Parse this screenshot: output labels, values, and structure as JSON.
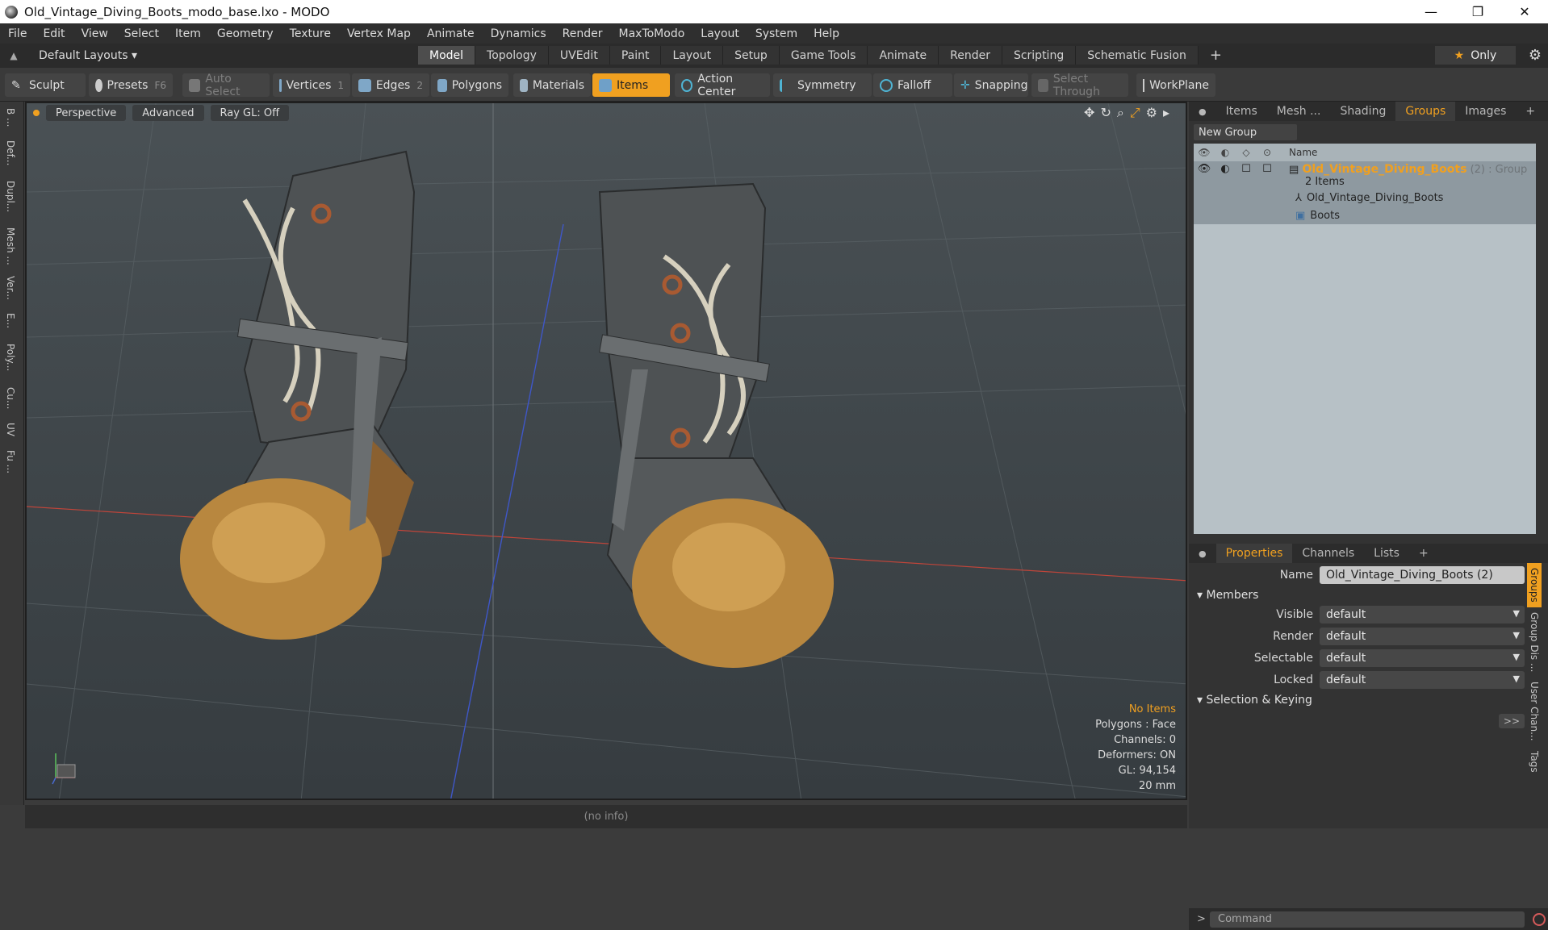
{
  "window": {
    "title": "Old_Vintage_Diving_Boots_modo_base.lxo - MODO",
    "minimize": "—",
    "maximize": "❐",
    "close": "✕"
  },
  "menu": [
    "File",
    "Edit",
    "View",
    "Select",
    "Item",
    "Geometry",
    "Texture",
    "Vertex Map",
    "Animate",
    "Dynamics",
    "Render",
    "MaxToModo",
    "Layout",
    "System",
    "Help"
  ],
  "layoutbar": {
    "layouts_label": "Default Layouts ▾",
    "tabs": [
      "Model",
      "Topology",
      "UVEdit",
      "Paint",
      "Layout",
      "Setup",
      "Game Tools",
      "Animate",
      "Render",
      "Scripting",
      "Schematic Fusion"
    ],
    "active_tab": "Model",
    "add": "+",
    "only_label": "Only"
  },
  "toolbar": {
    "sculpt": "Sculpt",
    "presets": "Presets",
    "presets_key": "F6",
    "auto_select": "Auto Select",
    "vertices": "Vertices",
    "vertices_num": "1",
    "edges": "Edges",
    "edges_num": "2",
    "polygons": "Polygons",
    "materials": "Materials",
    "items": "Items",
    "action_center": "Action Center",
    "symmetry": "Symmetry",
    "falloff": "Falloff",
    "snapping": "Snapping",
    "select_through": "Select Through",
    "workplane": "WorkPlane"
  },
  "left_tools": [
    "B ...",
    "Def...",
    "Dupl...",
    "Mesh ...",
    "Ver...",
    "E...",
    "Poly...",
    "Cu...",
    "UV",
    "Fu ..."
  ],
  "viewport": {
    "view": "Perspective",
    "shading": "Advanced",
    "raygl": "Ray GL: Off",
    "info": {
      "items": "No Items",
      "polygons": "Polygons : Face",
      "channels": "Channels: 0",
      "deformers": "Deformers: ON",
      "gl": "GL: 94,154",
      "grid": "20 mm"
    }
  },
  "status": "(no info)",
  "right_panel": {
    "tabs": [
      "Items",
      "Mesh ...",
      "Shading",
      "Groups",
      "Images"
    ],
    "active_tab": "Groups",
    "new_group": "New Group",
    "list_header": "Name",
    "rows": [
      {
        "name": "Old_Vintage_Diving_Boots",
        "suffix": "(2) : Group",
        "sub": "2 Items"
      },
      {
        "name": "Old_Vintage_Diving_Boots"
      },
      {
        "name": "Boots"
      }
    ]
  },
  "properties": {
    "tabs": [
      "Properties",
      "Channels",
      "Lists"
    ],
    "active_tab": "Properties",
    "name_label": "Name",
    "name_value": "Old_Vintage_Diving_Boots (2)",
    "members_section": "Members",
    "fields": [
      {
        "label": "Visible",
        "value": "default"
      },
      {
        "label": "Render",
        "value": "default"
      },
      {
        "label": "Selectable",
        "value": "default"
      },
      {
        "label": "Locked",
        "value": "default"
      }
    ],
    "selection_section": "Selection & Keying",
    "more": ">>",
    "side_tabs": [
      "Groups",
      "Group Dis ...",
      "User Chan...",
      "Tags"
    ]
  },
  "command": {
    "prompt": ">",
    "placeholder": "Command"
  }
}
